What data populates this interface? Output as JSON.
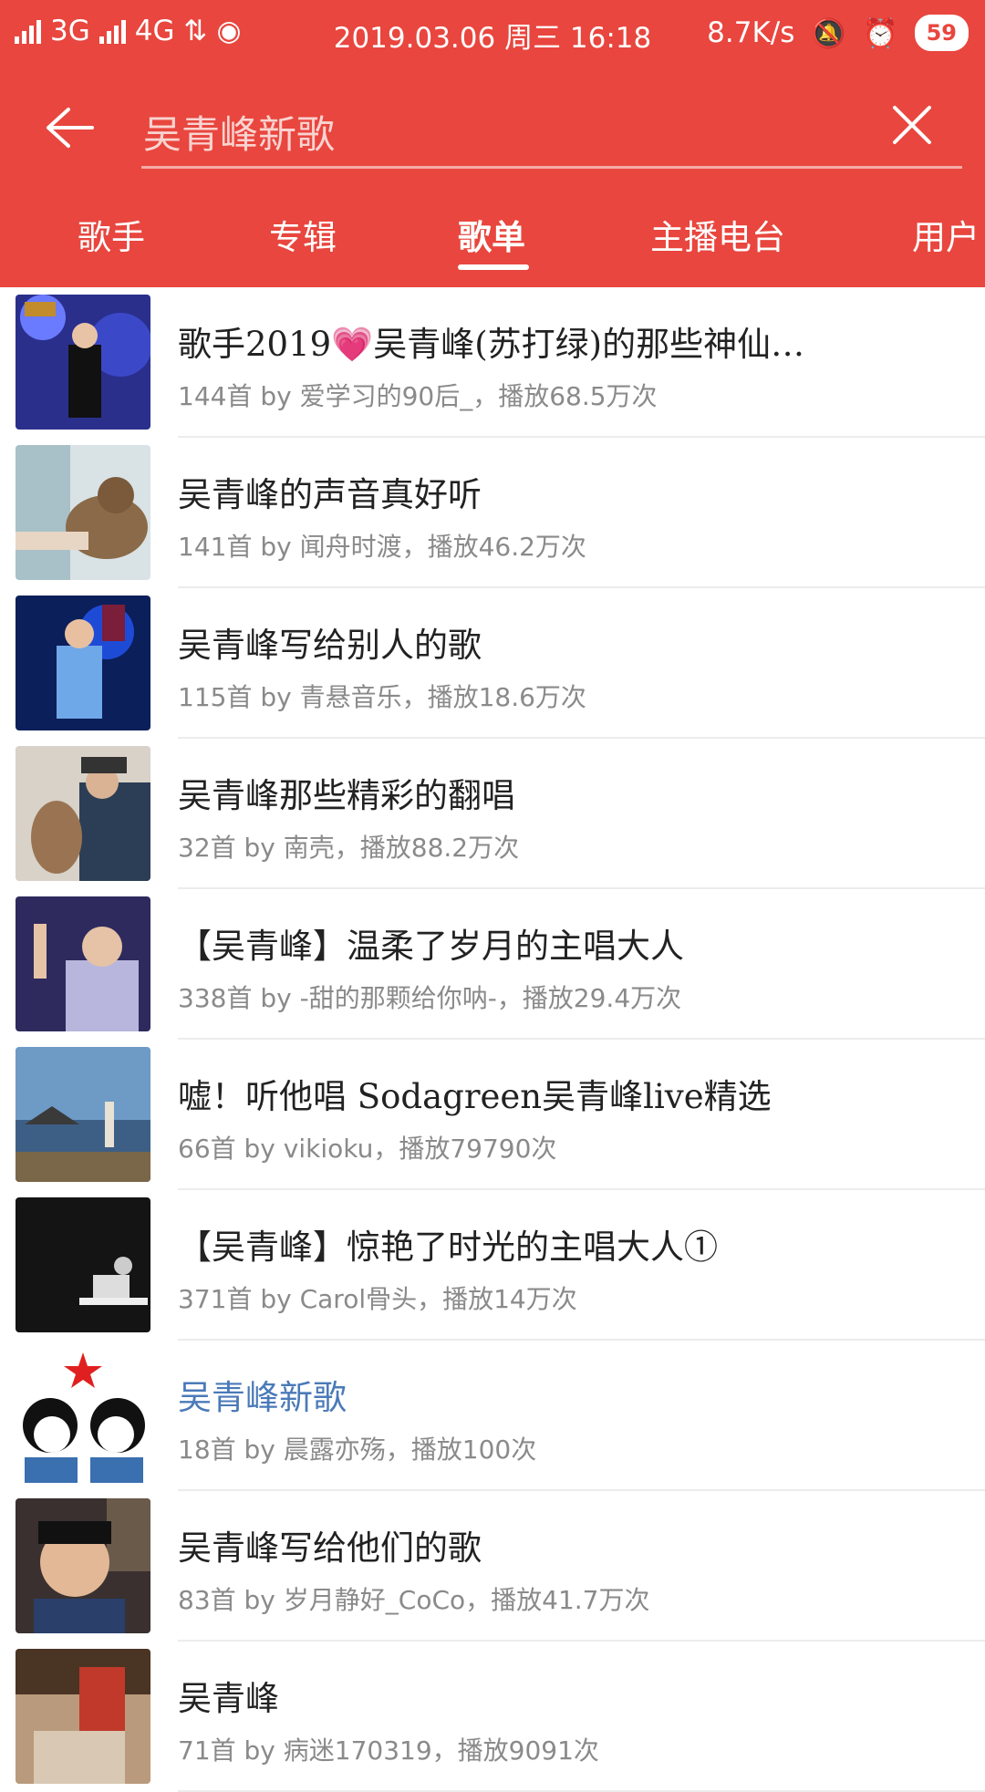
{
  "status": {
    "network1": "3G",
    "network2": "4G",
    "datetime": "2019.03.06 周三 16:18",
    "speed": "8.7K/s",
    "battery": "59"
  },
  "search": {
    "query": "吴青峰新歌"
  },
  "tabs": [
    "歌手",
    "专辑",
    "歌单",
    "主播电台",
    "用户"
  ],
  "active_tab": "歌单",
  "playlists": [
    {
      "title": "歌手2019💗吴青峰(苏打绿)的那些神仙…",
      "meta": "144首  by 爱学习的90后_，播放68.5万次"
    },
    {
      "title": "吴青峰的声音真好听",
      "meta": "141首  by 闻舟时渡，播放46.2万次"
    },
    {
      "title": "吴青峰写给别人的歌",
      "meta": "115首  by 青悬音乐，播放18.6万次"
    },
    {
      "title": "吴青峰那些精彩的翻唱",
      "meta": "32首  by 南壳，播放88.2万次"
    },
    {
      "title": "【吴青峰】温柔了岁月的主唱大人",
      "meta": "338首  by -甜的那颗给你呐-，播放29.4万次"
    },
    {
      "title": "嘘！听他唱 Sodagreen吴青峰live精选",
      "meta": "66首  by vikioku，播放79790次"
    },
    {
      "title": "【吴青峰】惊艳了时光的主唱大人①",
      "meta": "371首  by Carol骨头，播放14万次"
    },
    {
      "title": "吴青峰新歌",
      "meta": "18首  by 晨露亦殇，播放100次"
    },
    {
      "title": "吴青峰写给他们的歌",
      "meta": "83首  by 岁月静好_CoCo，播放41.7万次"
    },
    {
      "title": "吴青峰",
      "meta": "71首  by 病迷170319，播放9091次"
    }
  ],
  "colors": {
    "accent": "#e8463e",
    "highlight_title": "#4a7ab8"
  }
}
